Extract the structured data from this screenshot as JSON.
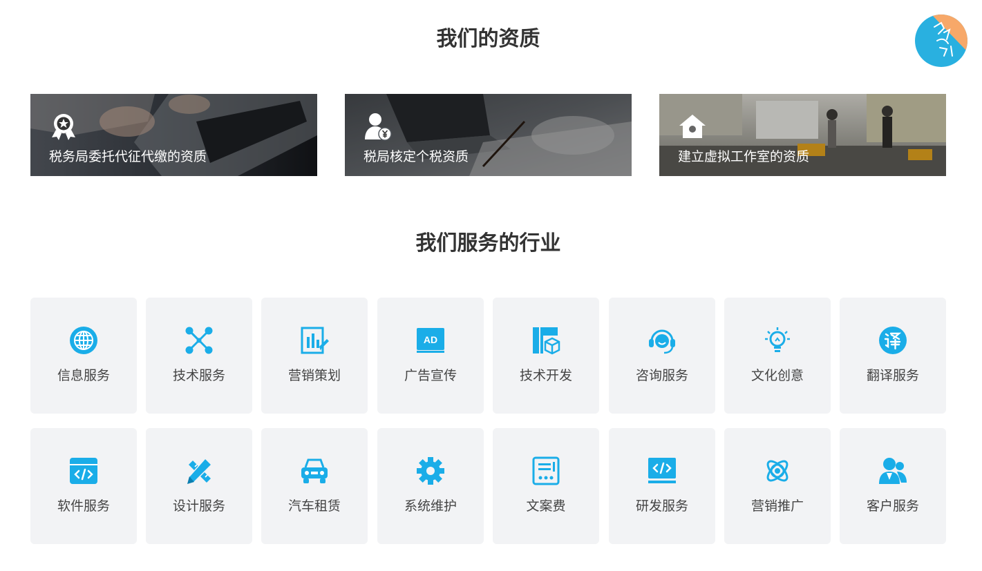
{
  "qualifications": {
    "title": "我们的资质",
    "items": [
      {
        "label": "税务局委托代征代缴的资质",
        "icon": "award-badge-icon"
      },
      {
        "label": "税局核定个税资质",
        "icon": "user-yuan-icon"
      },
      {
        "label": "建立虚拟工作室的资质",
        "icon": "house-icon"
      }
    ]
  },
  "industries": {
    "title": "我们服务的行业",
    "items": [
      {
        "label": "信息服务",
        "icon": "globe-icon"
      },
      {
        "label": "技术服务",
        "icon": "network-nodes-icon"
      },
      {
        "label": "营销策划",
        "icon": "chart-edit-icon"
      },
      {
        "label": "广告宣传",
        "icon": "ad-icon"
      },
      {
        "label": "技术开发",
        "icon": "cube-document-icon"
      },
      {
        "label": "咨询服务",
        "icon": "headset-icon"
      },
      {
        "label": "文化创意",
        "icon": "lightbulb-icon"
      },
      {
        "label": "翻译服务",
        "icon": "translate-icon"
      },
      {
        "label": "软件服务",
        "icon": "code-window-icon"
      },
      {
        "label": "设计服务",
        "icon": "pencil-ruler-icon"
      },
      {
        "label": "汽车租赁",
        "icon": "car-icon"
      },
      {
        "label": "系统维护",
        "icon": "gear-icon"
      },
      {
        "label": "文案费",
        "icon": "document-list-icon"
      },
      {
        "label": "研发服务",
        "icon": "code-monitor-icon"
      },
      {
        "label": "营销推广",
        "icon": "atom-icon"
      },
      {
        "label": "客户服务",
        "icon": "customer-icon"
      }
    ]
  },
  "colors": {
    "accent": "#1aade8",
    "card_bg": "#f2f3f5",
    "title": "#333333"
  }
}
